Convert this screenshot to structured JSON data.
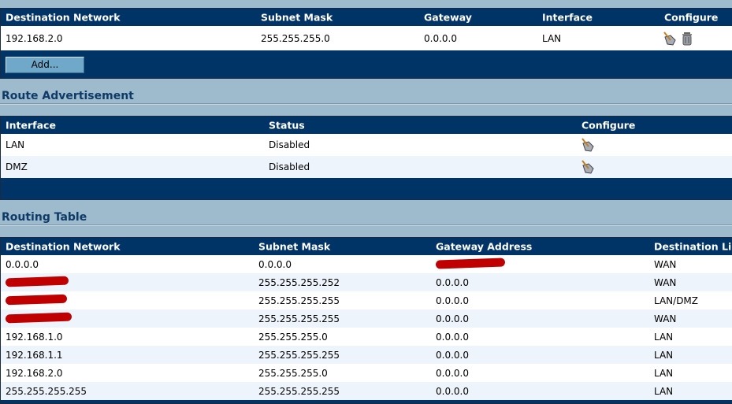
{
  "static_routes": {
    "headers": [
      "Destination Network",
      "Subnet Mask",
      "Gateway",
      "Interface",
      "Configure"
    ],
    "rows": [
      {
        "dest": "192.168.2.0",
        "mask": "255.255.255.0",
        "gw": "0.0.0.0",
        "iface": "LAN",
        "icons": [
          "edit-icon",
          "delete-icon"
        ]
      }
    ],
    "add_label": "Add..."
  },
  "route_advertisement": {
    "title": "Route Advertisement",
    "headers": [
      "Interface",
      "Status",
      "Configure"
    ],
    "rows": [
      {
        "iface": "LAN",
        "status": "Disabled"
      },
      {
        "iface": "DMZ",
        "status": "Disabled"
      }
    ]
  },
  "routing_table": {
    "title": "Routing Table",
    "headers": [
      "Destination Network",
      "Subnet Mask",
      "Gateway Address",
      "Destination Lin"
    ],
    "rows": [
      {
        "dest": "0.0.0.0",
        "mask": "0.0.0.0",
        "gw": null,
        "link": "WAN"
      },
      {
        "dest": null,
        "mask": "255.255.255.252",
        "gw": "0.0.0.0",
        "link": "WAN"
      },
      {
        "dest": null,
        "mask": "255.255.255.255",
        "gw": "0.0.0.0",
        "link": "LAN/DMZ"
      },
      {
        "dest": null,
        "mask": "255.255.255.255",
        "gw": "0.0.0.0",
        "link": "WAN"
      },
      {
        "dest": "192.168.1.0",
        "mask": "255.255.255.0",
        "gw": "0.0.0.0",
        "link": "LAN"
      },
      {
        "dest": "192.168.1.1",
        "mask": "255.255.255.255",
        "gw": "0.0.0.0",
        "link": "LAN"
      },
      {
        "dest": "192.168.2.0",
        "mask": "255.255.255.0",
        "gw": "0.0.0.0",
        "link": "LAN"
      },
      {
        "dest": "255.255.255.255",
        "mask": "255.255.255.255",
        "gw": "0.0.0.0",
        "link": "LAN"
      }
    ]
  }
}
